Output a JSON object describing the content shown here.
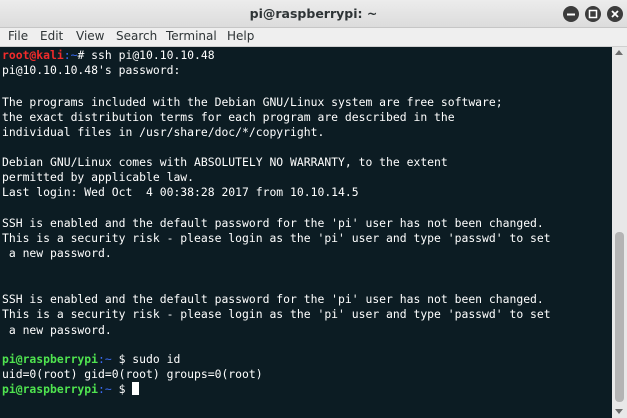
{
  "window": {
    "title": "pi@raspberrypi: ~",
    "buttons": [
      "minimize",
      "maximize",
      "close"
    ]
  },
  "menu": {
    "items": [
      "File",
      "Edit",
      "View",
      "Search",
      "Terminal",
      "Help"
    ]
  },
  "terminal": {
    "colors": {
      "root_prompt": "#f12b2b",
      "path": "#3b6cf5",
      "pi_prompt": "#4fe34f",
      "text": "#ffffff",
      "background": "#0c1c23"
    },
    "line1": {
      "user": "root@kali",
      "path": ":~",
      "rest": "# ssh pi@10.10.10.48"
    },
    "line2": "pi@10.10.10.48's password:",
    "line4": "The programs included with the Debian GNU/Linux system are free software;",
    "line5": "the exact distribution terms for each program are described in the",
    "line6": "individual files in /usr/share/doc/*/copyright.",
    "line8": "Debian GNU/Linux comes with ABSOLUTELY NO WARRANTY, to the extent",
    "line9": "permitted by applicable law.",
    "line10": "Last login: Wed Oct  4 00:38:28 2017 from 10.10.14.5",
    "line12": "SSH is enabled and the default password for the 'pi' user has not been changed.",
    "line13": "This is a security risk - please login as the 'pi' user and type 'passwd' to set",
    "line14": " a new password.",
    "line17": "SSH is enabled and the default password for the 'pi' user has not been changed.",
    "line18": "This is a security risk - please login as the 'pi' user and type 'passwd' to set",
    "line19": " a new password.",
    "line21": {
      "user": "pi@raspberrypi",
      "path": ":~",
      "rest": " $ sudo id"
    },
    "line22": "uid=0(root) gid=0(root) groups=0(root)",
    "line23": {
      "user": "pi@raspberrypi",
      "path": ":~",
      "rest": " $ "
    }
  }
}
